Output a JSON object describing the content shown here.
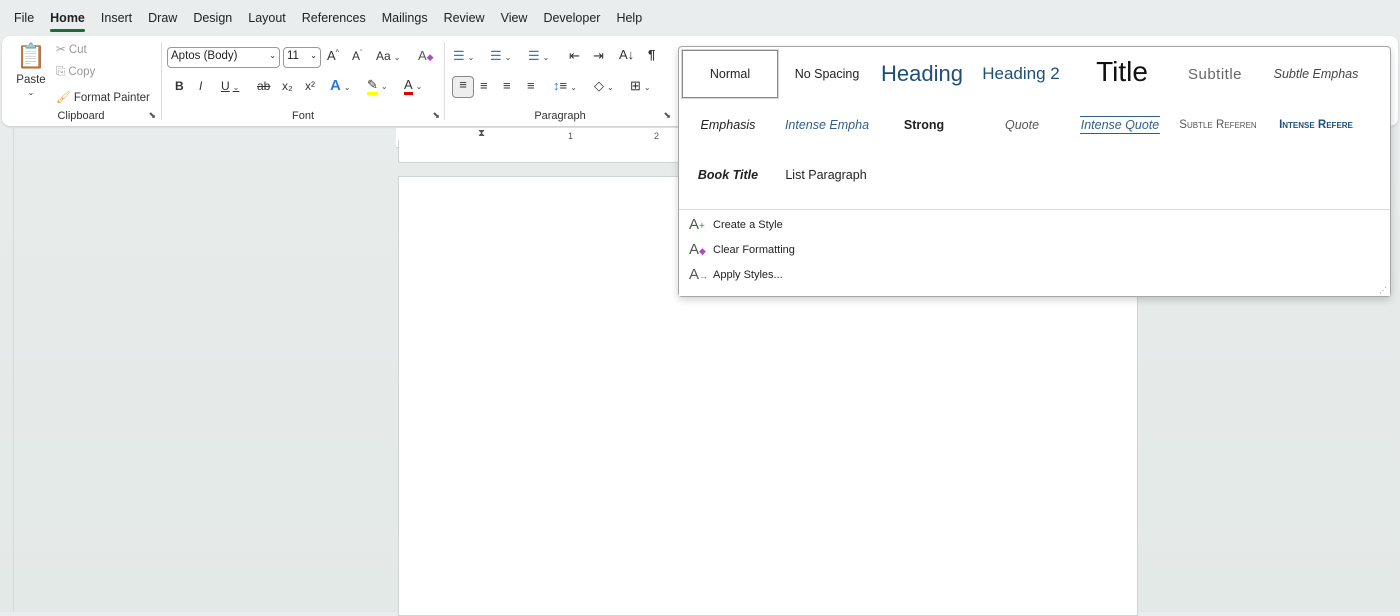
{
  "tabs": [
    "File",
    "Home",
    "Insert",
    "Draw",
    "Design",
    "Layout",
    "References",
    "Mailings",
    "Review",
    "View",
    "Developer",
    "Help"
  ],
  "active_tab": "Home",
  "clipboard": {
    "paste": "Paste",
    "cut": "Cut",
    "copy": "Copy",
    "format_painter": "Format Painter",
    "label": "Clipboard"
  },
  "font": {
    "name": "Aptos (Body)",
    "size": "11",
    "label": "Font",
    "change_case": "Aa",
    "bold": "B",
    "italic": "I",
    "underline": "U",
    "strike": "ab",
    "sub": "x₂",
    "sup": "x²",
    "highlight_color": "#ffff00",
    "font_color": "#e00000"
  },
  "paragraph": {
    "label": "Paragraph",
    "pilcrow": "¶"
  },
  "ruler": {
    "marks": [
      "1",
      "2"
    ]
  },
  "styles": {
    "items": [
      "Normal",
      "No Spacing",
      "Heading",
      "Heading 2",
      "Title",
      "Subtitle",
      "Subtle Emphas",
      "Emphasis",
      "Intense Empha",
      "Strong",
      "Quote",
      "Intense Quote",
      "Subtle Referen",
      "Intense Refere",
      "Book Title",
      "List Paragraph"
    ],
    "selected": "Normal",
    "menu": [
      "Create a Style",
      "Clear Formatting",
      "Apply Styles..."
    ]
  }
}
